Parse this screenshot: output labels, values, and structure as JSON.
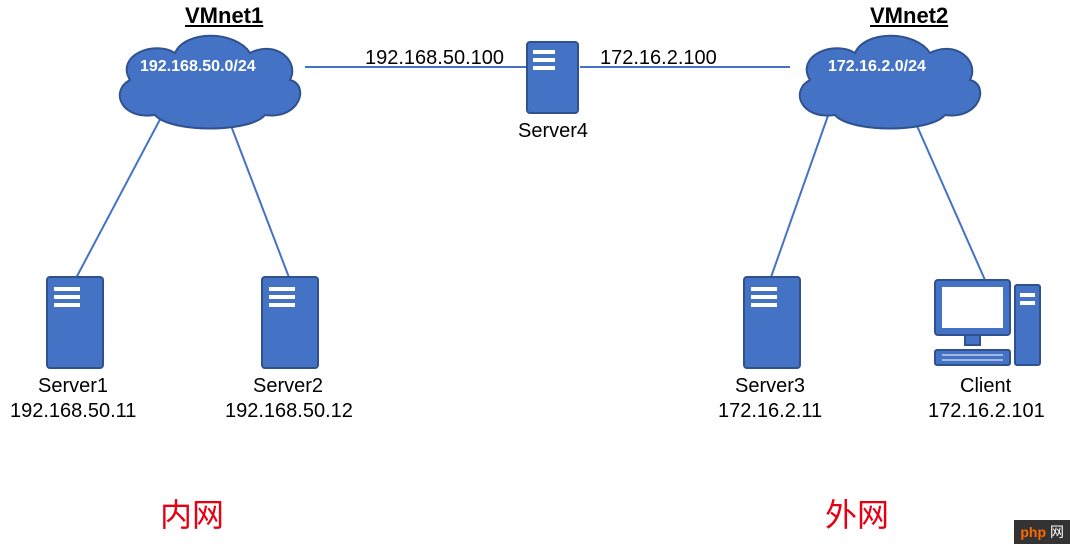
{
  "clouds": {
    "vmnet1": {
      "title": "VMnet1",
      "cidr": "192.168.50.0/24"
    },
    "vmnet2": {
      "title": "VMnet2",
      "cidr": "172.16.2.0/24"
    }
  },
  "gateway": {
    "name": "Server4",
    "left_ip": "192.168.50.100",
    "right_ip": "172.16.2.100"
  },
  "servers": {
    "s1": {
      "name": "Server1",
      "ip": "192.168.50.11"
    },
    "s2": {
      "name": "Server2",
      "ip": "192.168.50.12"
    },
    "s3": {
      "name": "Server3",
      "ip": "172.16.2.11"
    }
  },
  "client": {
    "name": "Client",
    "ip": "172.16.2.101"
  },
  "zones": {
    "left": "内网",
    "right": "外网"
  },
  "watermark": {
    "brand_prefix": "php",
    "brand_suffix": "网"
  }
}
